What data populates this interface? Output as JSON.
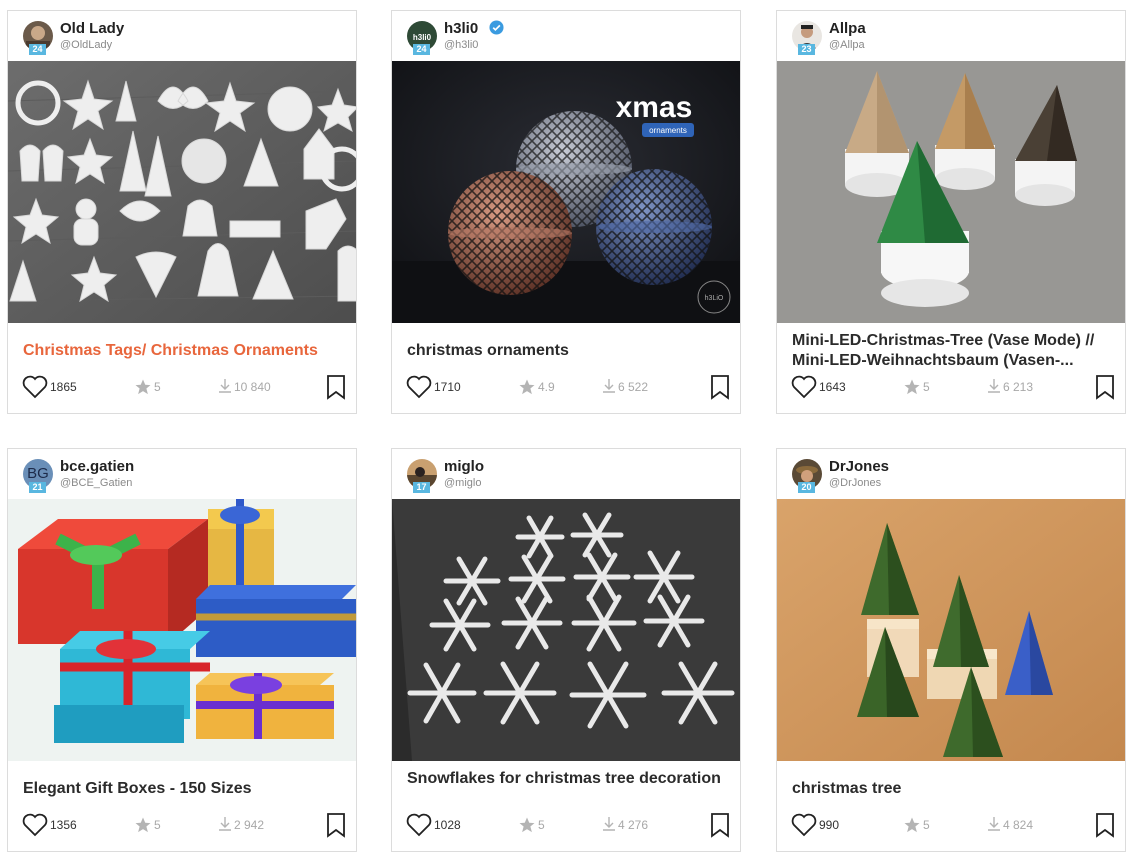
{
  "cards": [
    {
      "user": {
        "name": "Old Lady",
        "handle": "@OldLady",
        "level": "24",
        "verified": false
      },
      "title": "Christmas Tags/ Christmas Ornaments",
      "likes": "1865",
      "rating": "5",
      "downloads": "10 840"
    },
    {
      "user": {
        "name": "h3li0",
        "handle": "@h3li0",
        "level": "24",
        "verified": true,
        "avatar_text": "h3li0"
      },
      "image_text": {
        "headline": "xmas",
        "tag": "ornaments",
        "watermark": "h3LiO"
      },
      "title": "christmas ornaments",
      "likes": "1710",
      "rating": "4.9",
      "downloads": "6 522"
    },
    {
      "user": {
        "name": "Allpa",
        "handle": "@Allpa",
        "level": "23",
        "verified": false
      },
      "title": "Mini-LED-Christmas-Tree (Vase Mode) // Mini-LED-Weihnachtsbaum (Vasen-...",
      "likes": "1643",
      "rating": "5",
      "downloads": "6 213"
    },
    {
      "user": {
        "name": "bce.gatien",
        "handle": "@BCE_Gatien",
        "level": "21",
        "verified": false,
        "avatar_text": "BG"
      },
      "title": "Elegant Gift Boxes - 150 Sizes",
      "likes": "1356",
      "rating": "5",
      "downloads": "2 942"
    },
    {
      "user": {
        "name": "miglo",
        "handle": "@miglo",
        "level": "17",
        "verified": false
      },
      "title": "Snowflakes for christmas tree decoration",
      "likes": "1028",
      "rating": "5",
      "downloads": "4 276"
    },
    {
      "user": {
        "name": "DrJones",
        "handle": "@DrJones",
        "level": "20",
        "verified": false
      },
      "title": "christmas tree",
      "likes": "990",
      "rating": "5",
      "downloads": "4 824"
    }
  ],
  "colors": {
    "accent_title": "#e8663c",
    "level_badge": "#59b7e0",
    "verified_badge": "#3a9be0",
    "muted": "#a8a8a8"
  },
  "icons": [
    "heart-icon",
    "star-icon",
    "download-icon",
    "bookmark-icon",
    "verified-icon"
  ]
}
